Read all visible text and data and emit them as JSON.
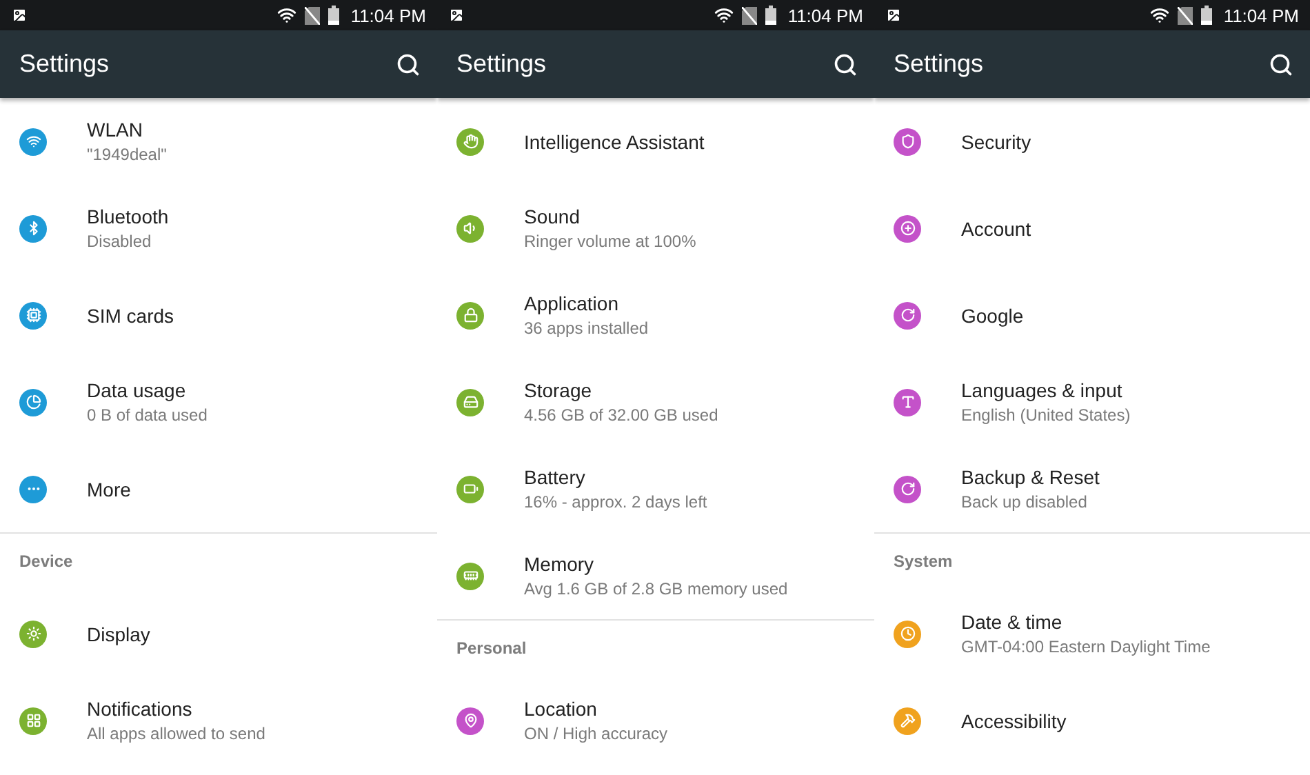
{
  "screens": [
    {
      "status_bar": {
        "time": "11:04 PM"
      },
      "toolbar": {
        "title": "Settings"
      },
      "items": [
        {
          "kind": "setting",
          "title": "WLAN",
          "subtitle": "\"1949deal\"",
          "color": "#1e9bd7"
        },
        {
          "kind": "setting",
          "title": "Bluetooth",
          "subtitle": "Disabled",
          "color": "#1e9bd7"
        },
        {
          "kind": "setting",
          "title": "SIM cards",
          "color": "#1e9bd7"
        },
        {
          "kind": "setting",
          "title": "Data usage",
          "subtitle": "0 B of data used",
          "color": "#1e9bd7"
        },
        {
          "kind": "setting",
          "title": "More",
          "color": "#1e9bd7"
        },
        {
          "kind": "header",
          "title": "Device"
        },
        {
          "kind": "setting",
          "title": "Display",
          "color": "#7cb230"
        },
        {
          "kind": "setting",
          "title": "Notifications",
          "subtitle": "All apps allowed to send",
          "color": "#7cb230"
        }
      ]
    },
    {
      "status_bar": {
        "time": "11:04 PM"
      },
      "toolbar": {
        "title": "Settings"
      },
      "items": [
        {
          "kind": "setting",
          "title": "Intelligence Assistant",
          "color": "#7cb230"
        },
        {
          "kind": "setting",
          "title": "Sound",
          "subtitle": "Ringer volume at 100%",
          "color": "#7cb230"
        },
        {
          "kind": "setting",
          "title": "Application",
          "subtitle": "36 apps installed",
          "color": "#7cb230"
        },
        {
          "kind": "setting",
          "title": "Storage",
          "subtitle": "4.56 GB of 32.00 GB used",
          "color": "#7cb230"
        },
        {
          "kind": "setting",
          "title": "Battery",
          "subtitle": "16% - approx. 2 days left",
          "color": "#7cb230"
        },
        {
          "kind": "setting",
          "title": "Memory",
          "subtitle": "Avg 1.6 GB of 2.8 GB memory used",
          "color": "#7cb230"
        },
        {
          "kind": "header",
          "title": "Personal"
        },
        {
          "kind": "setting",
          "title": "Location",
          "subtitle": "ON / High accuracy",
          "color": "#c452c9"
        }
      ]
    },
    {
      "status_bar": {
        "time": "11:04 PM"
      },
      "toolbar": {
        "title": "Settings"
      },
      "items": [
        {
          "kind": "setting",
          "title": "Security",
          "color": "#c452c9"
        },
        {
          "kind": "setting",
          "title": "Account",
          "color": "#c452c9"
        },
        {
          "kind": "setting",
          "title": "Google",
          "color": "#c452c9"
        },
        {
          "kind": "setting",
          "title": "Languages & input",
          "subtitle": "English (United States)",
          "color": "#c452c9"
        },
        {
          "kind": "setting",
          "title": "Backup & Reset",
          "subtitle": "Back up disabled",
          "color": "#c452c9"
        },
        {
          "kind": "header",
          "title": "System"
        },
        {
          "kind": "setting",
          "title": "Date & time",
          "subtitle": "GMT-04:00 Eastern Daylight Time",
          "color": "#f0a21e"
        },
        {
          "kind": "setting",
          "title": "Accessibility",
          "color": "#f0a21e"
        }
      ]
    }
  ]
}
